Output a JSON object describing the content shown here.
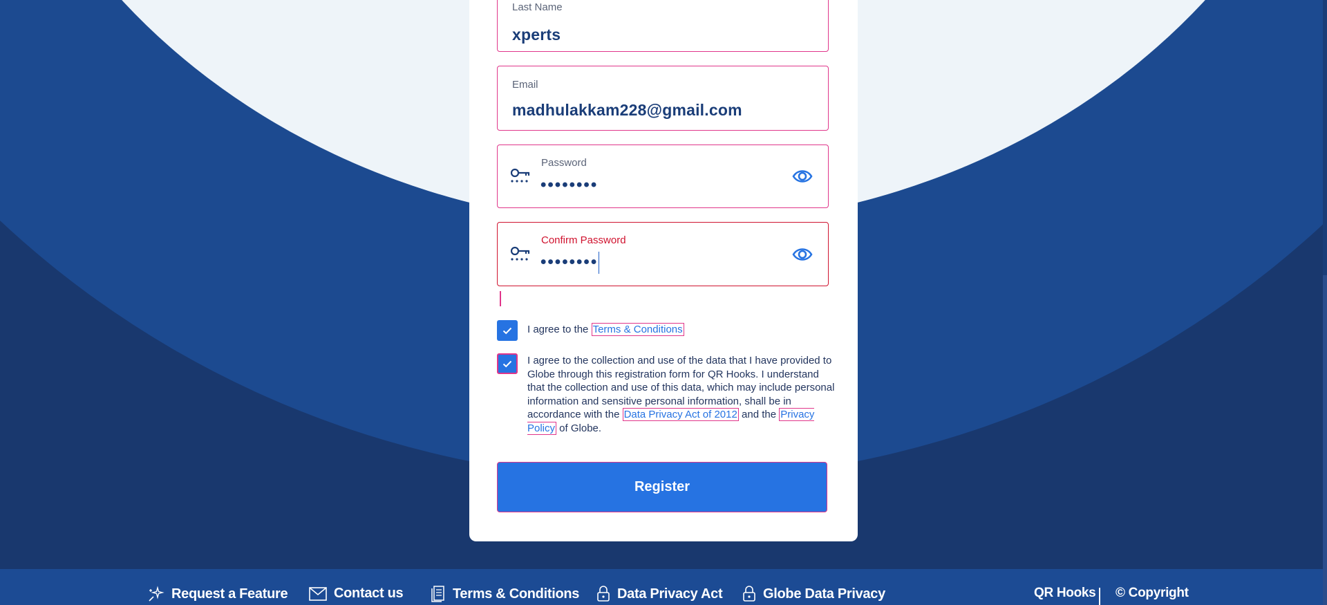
{
  "form": {
    "last_name": {
      "label": "Last Name",
      "value": "xperts"
    },
    "email": {
      "label": "Email",
      "value": "madhulakkam228@gmail.com"
    },
    "password": {
      "label": "Password",
      "value": "••••••••",
      "key_icon": "key-icon",
      "toggle_icon": "eye-icon"
    },
    "confirm_password": {
      "label": "Confirm Password",
      "value": "••••••••",
      "key_icon": "key-icon",
      "toggle_icon": "eye-icon"
    },
    "terms_consent": {
      "checked": true,
      "prefix": "I agree to the ",
      "link": "Terms & Conditions"
    },
    "data_consent": {
      "checked": true,
      "text_before": "I agree to the collection and use of the data that I have provided to Globe through this registration form for QR Hooks. I understand that the collection and use of this data, which may include personal information and sensitive personal information, shall be in accordance with the ",
      "link_dpa": "Data Privacy Act of 2012",
      "text_middle": " and the ",
      "link_privacy": "Privacy Policy",
      "text_after": " of Globe."
    },
    "register_label": "Register"
  },
  "footer": {
    "links": [
      {
        "label": "Request a Feature",
        "icon": "sparkle-icon"
      },
      {
        "label": "Contact us",
        "icon": "envelope-icon"
      },
      {
        "label": "Terms & Conditions",
        "icon": "document-icon"
      },
      {
        "label": "Data Privacy Act",
        "icon": "lock-icon"
      },
      {
        "label": "Globe Data Privacy",
        "icon": "lock-icon"
      }
    ],
    "brand": "QR Hooks",
    "copyright": "© Copyright"
  },
  "colors": {
    "accent": "#2673e2",
    "navy": "#1a3d78",
    "focus_outline": "#e0358a",
    "error": "#d0122e"
  }
}
